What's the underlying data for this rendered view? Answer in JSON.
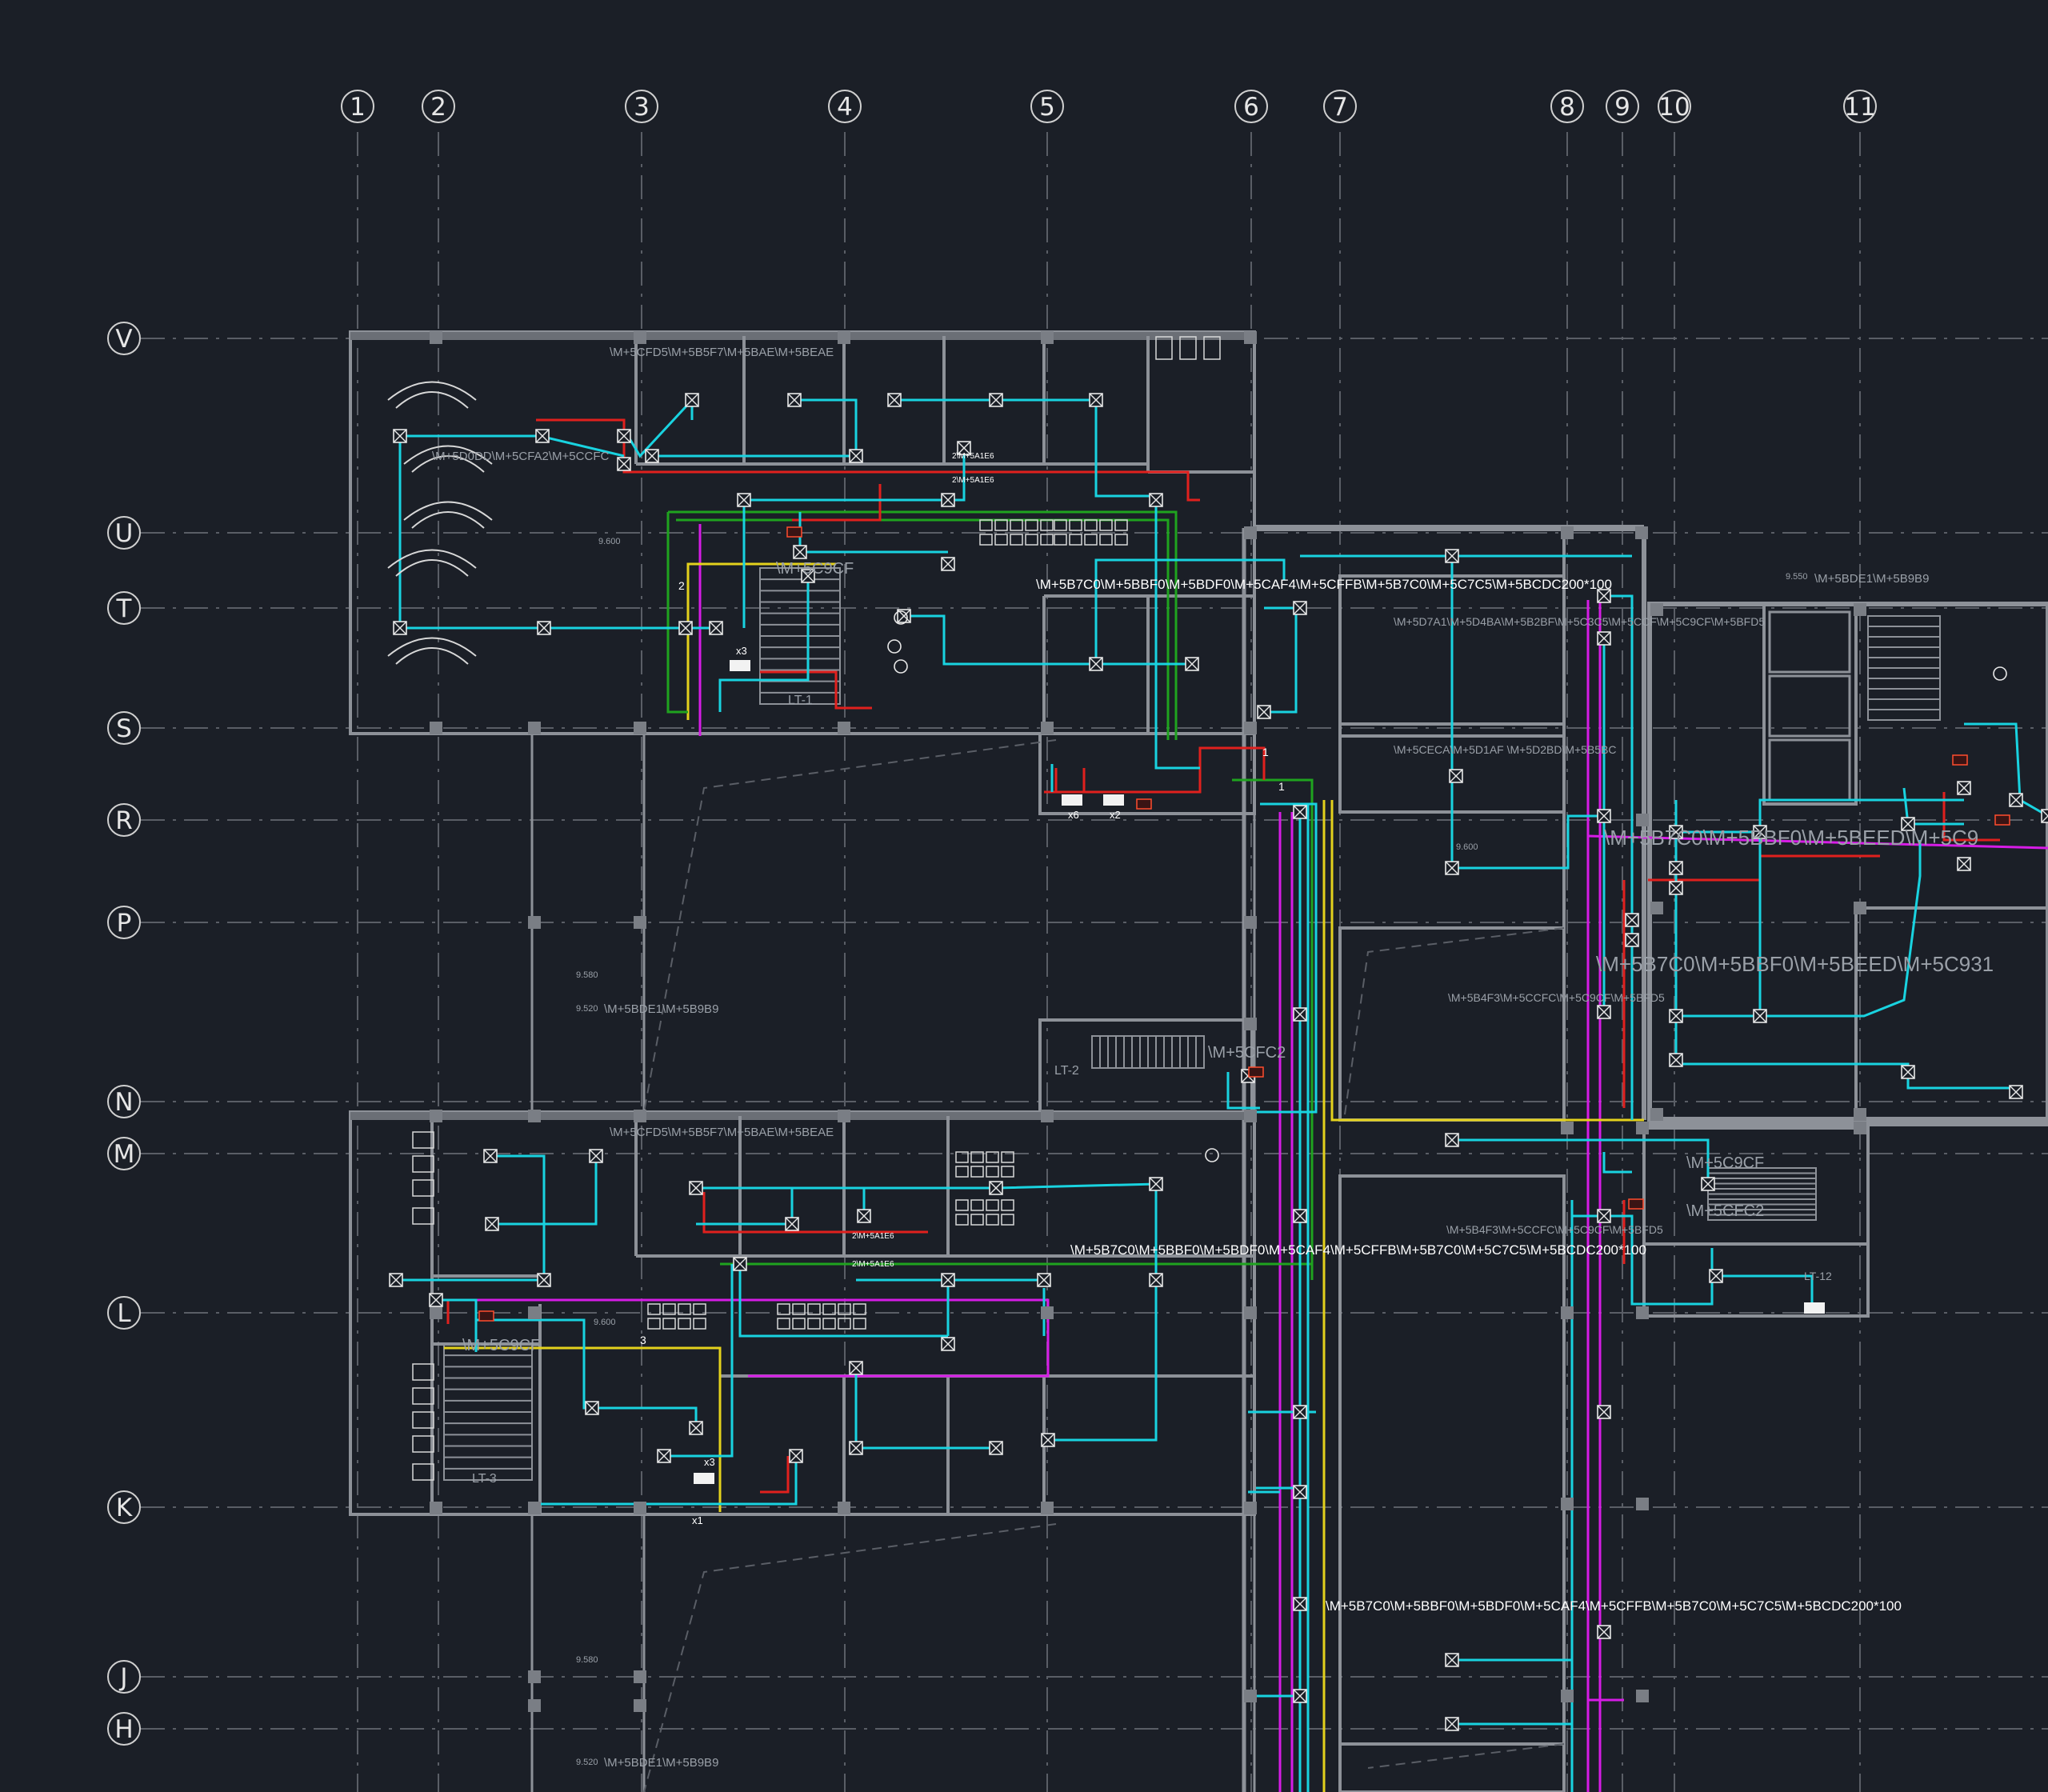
{
  "colors": {
    "background": "#1b1f27",
    "grid_line": "#5a5e66",
    "wall": "#8d9198",
    "column": "#7a7e85",
    "cyan": "#19d3e0",
    "red": "#e0201e",
    "magenta": "#d61ce6",
    "yellow": "#e4d21c",
    "green": "#1fa31f",
    "label_dim": "#9aa0a8",
    "label_bright": "#ffffff"
  },
  "grid_axes": {
    "columns": [
      "1",
      "2",
      "3",
      "4",
      "5",
      "6",
      "7",
      "8",
      "9",
      "10",
      "11"
    ],
    "rows": [
      "V",
      "U",
      "T",
      "S",
      "R",
      "P",
      "N",
      "M",
      "L",
      "K",
      "J",
      "H"
    ]
  },
  "labels": {
    "duct_1": "\\M+5B7C0\\M+5BBF0\\M+5BDF0\\M+5CAF4\\M+5CFFB\\M+5B7C0\\M+5C7C5\\M+5BCDC200*100",
    "duct_2": "\\M+5B7C0\\M+5BBF0\\M+5BDF0\\M+5CAF4\\M+5CFFB\\M+5B7C0\\M+5C7C5\\M+5BCDC200*100",
    "duct_3": "\\M+5B7C0\\M+5BBF0\\M+5BDF0\\M+5CAF4\\M+5CFFB\\M+5B7C0\\M+5C7C5\\M+5BCDC200*100",
    "room_east_1": "\\M+5B7C0\\M+5BBF0\\M+5BEED\\M+5C9",
    "room_east_2": "\\M+5B7C0\\M+5BBF0\\M+5BEED\\M+5C931",
    "lvl_9550": "9.550",
    "lvl_9550_text": "\\M+5BDE1\\M+5B9B9",
    "lvl_9580_a": "9.580",
    "lvl_9520_a": "9.520",
    "lvl_9520_a_text": "\\M+5BDE1\\M+5B9B9",
    "lvl_9580_b": "9.580",
    "lvl_9520_b": "9.520",
    "lvl_9520_b_text": "\\M+5BDE1\\M+5B9B9",
    "lvl_9600_a": "9.600",
    "lvl_9600_b": "9.600",
    "lvl_9600_c": "9.600",
    "lt1": "LT-1",
    "lt2": "LT-2",
    "lt3": "LT-3",
    "lt12": "LT-12",
    "stair_top": "\\M+5C9CF",
    "stair_bot": "\\M+5C9CF",
    "mid_tag": "\\M+5CFC2",
    "east_tag_1": "\\M+5C9CF",
    "east_tag_2": "\\M+5CFC2",
    "room_a": "\\M+5D0DD\\M+5CFA2\\M+5CCFC",
    "room_b": "\\M+5CFD5\\M+5B5F7\\M+5BAE\\M+5BEAE",
    "room_c": "\\M+5CECA\\M+5D1AF \\M+5D2BD\\M+5B5BC",
    "room_d": "\\M+5D7A1\\M+5D4BA\\M+5B2BF\\M+5C3C5\\M+5CCF\\M+5C9CF\\M+5BFD5",
    "room_e": "\\M+5B4F3\\M+5CCFC\\M+5C9CF\\M+5BFD5",
    "room_f": "\\M+5B4F3\\M+5CCFC\\M+5C9CF\\M+5BFD5",
    "room_g": "\\M+5CFD5\\M+5B5F7\\M+5BAE\\M+5BEAE",
    "n1": "1",
    "n2": "2",
    "n3": "3",
    "x1": "x1",
    "x2": "x2",
    "x3": "x3",
    "x6": "x6",
    "tag_2sp": "2\\M+5A1E6"
  }
}
